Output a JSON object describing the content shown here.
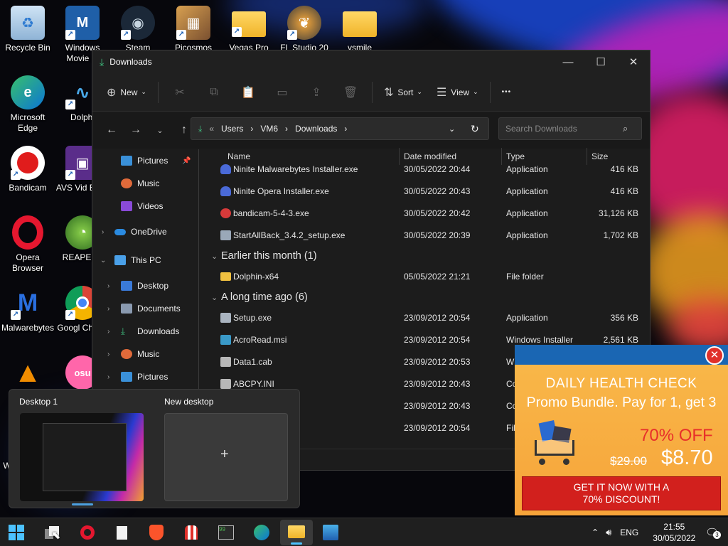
{
  "desktop_icons": [
    {
      "label": "Recycle Bin",
      "icon": "recycle-bin-icon"
    },
    {
      "label": "Windows Movie M",
      "icon": "movie-maker-icon"
    },
    {
      "label": "Steam",
      "icon": "steam-icon"
    },
    {
      "label": "Picosmos",
      "icon": "picosmos-icon"
    },
    {
      "label": "Vegas Pro",
      "icon": "folder-icon"
    },
    {
      "label": "FL Studio 20",
      "icon": "fl-studio-icon"
    },
    {
      "label": "vsmile",
      "icon": "folder-icon"
    },
    {
      "label": "Microsoft Edge",
      "icon": "edge-icon"
    },
    {
      "label": "Dolphi",
      "icon": "dolphin-icon"
    },
    {
      "label": "Bandicam",
      "icon": "bandicam-icon"
    },
    {
      "label": "AVS Vid Edito",
      "icon": "avs-icon"
    },
    {
      "label": "Opera Browser",
      "icon": "opera-icon"
    },
    {
      "label": "REAPER (",
      "icon": "reaper-icon"
    },
    {
      "label": "Malwarebytes",
      "icon": "malwarebytes-icon"
    },
    {
      "label": "Googl Chrom",
      "icon": "chrome-icon"
    },
    {
      "label": "W",
      "icon": "vlc-icon"
    }
  ],
  "explorer": {
    "title": "Downloads",
    "toolbar": {
      "new": "New",
      "sort": "Sort",
      "view": "View",
      "more": "•••"
    },
    "breadcrumb": [
      "Users",
      "VM6",
      "Downloads"
    ],
    "search_placeholder": "Search Downloads",
    "nav": [
      "Pictures",
      "Music",
      "Videos",
      "OneDrive",
      "This PC",
      "Desktop",
      "Documents",
      "Downloads",
      "Music",
      "Pictures"
    ],
    "columns": {
      "name": "Name",
      "date": "Date modified",
      "type": "Type",
      "size": "Size"
    },
    "group_earlier": "Earlier this month (1)",
    "group_long": "A long time ago (6)",
    "files": [
      {
        "name": "Ninite Malwarebytes Installer.exe",
        "date": "30/05/2022 20:44",
        "type": "Application",
        "size": "416 KB"
      },
      {
        "name": "Ninite Opera Installer.exe",
        "date": "30/05/2022 20:43",
        "type": "Application",
        "size": "416 KB"
      },
      {
        "name": "bandicam-5-4-3.exe",
        "date": "30/05/2022 20:42",
        "type": "Application",
        "size": "31,126 KB"
      },
      {
        "name": "StartAllBack_3.4.2_setup.exe",
        "date": "30/05/2022 20:39",
        "type": "Application",
        "size": "1,702 KB"
      },
      {
        "name": "Dolphin-x64",
        "date": "05/05/2022 21:21",
        "type": "File folder",
        "size": ""
      },
      {
        "name": "Setup.exe",
        "date": "23/09/2012 20:54",
        "type": "Application",
        "size": "356 KB"
      },
      {
        "name": "AcroRead.msi",
        "date": "23/09/2012 20:54",
        "type": "Windows Installer",
        "size": "2,561 KB"
      },
      {
        "name": "Data1.cab",
        "date": "23/09/2012 20:53",
        "type": "W",
        "size": ""
      },
      {
        "name": "ABCPY.INI",
        "date": "23/09/2012 20:43",
        "type": "Co",
        "size": ""
      },
      {
        "name": "",
        "date": "23/09/2012 20:43",
        "type": "Co",
        "size": ""
      },
      {
        "name": "",
        "date": "23/09/2012 20:54",
        "type": "Fil",
        "size": ""
      }
    ]
  },
  "task_view": {
    "desktop1": "Desktop 1",
    "new_desktop": "New desktop",
    "plus": "+"
  },
  "ad": {
    "headline": "DAILY HEALTH CHECK",
    "subline": "Promo Bundle. Pay for 1, get 3",
    "discount": "70% OFF",
    "old_price": "$29.00",
    "new_price": "$8.70",
    "cta_line1": "GET IT NOW WITH A",
    "cta_line2": "70% DISCOUNT!"
  },
  "taskbar": {
    "lang": "ENG",
    "time": "21:55",
    "date": "30/05/2022",
    "notif_count": "3"
  }
}
